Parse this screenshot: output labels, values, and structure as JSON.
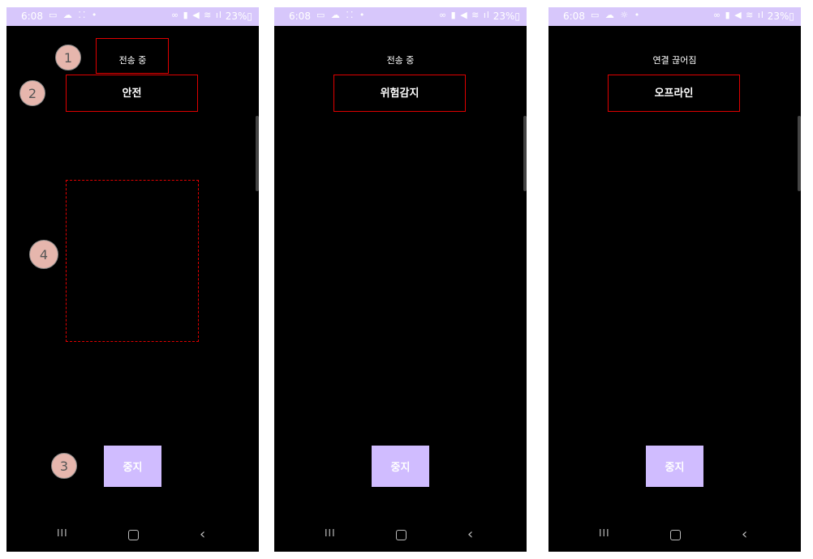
{
  "screens": [
    {
      "status_bar": {
        "time": "6:08",
        "left_icons": "▭ ☁ ⁚⁚ •",
        "right_icons": "∞ ▮ ◀ ≋ ıl",
        "battery": "23%▯"
      },
      "status_text": "전송 중",
      "state_label": "안전",
      "stop_button": "중지",
      "nav": {
        "recent": "III",
        "home": "",
        "back": "‹"
      }
    },
    {
      "status_bar": {
        "time": "6:08",
        "left_icons": "▭ ☁ ⁚⁚ •",
        "right_icons": "∞ ▮ ◀ ≋ ıl",
        "battery": "23%▯"
      },
      "status_text": "전송 중",
      "state_label": "위험감지",
      "stop_button": "중지",
      "nav": {
        "recent": "III",
        "home": "",
        "back": "‹"
      }
    },
    {
      "status_bar": {
        "time": "6:08",
        "left_icons": "▭ ☁ ☼ •",
        "right_icons": "∞ ▮ ◀ ≋ ıl",
        "battery": "23%▯"
      },
      "status_text": "연결 끊어짐",
      "state_label": "오프라인",
      "stop_button": "중지",
      "nav": {
        "recent": "III",
        "home": "",
        "back": "‹"
      }
    }
  ],
  "annotations": {
    "markers": [
      "1",
      "2",
      "3",
      "4"
    ]
  },
  "colors": {
    "status_bar_bg": "#d7c7fb",
    "button_bg": "#d0bcff",
    "annotation_red": "#e00000",
    "marker_fill": "#e6b6ad"
  },
  "icons": {
    "status_left": [
      "message-icon",
      "cloud-icon",
      "dots-icon"
    ],
    "status_right": [
      "link-icon",
      "battery-saver-icon",
      "mute-icon",
      "wifi-icon",
      "signal-icon"
    ],
    "nav": [
      "recent-apps-icon",
      "home-icon",
      "back-icon"
    ]
  }
}
